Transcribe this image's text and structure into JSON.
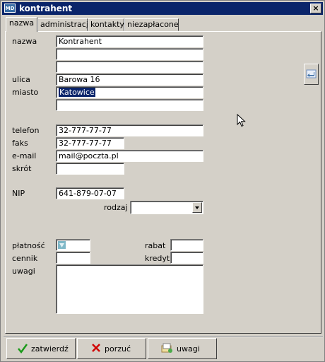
{
  "window": {
    "title": "kontrahent",
    "icon_text": "MD",
    "close_label": "×"
  },
  "tabs": [
    {
      "label": "nazwa",
      "active": true
    },
    {
      "label": "administracja",
      "active": false
    },
    {
      "label": "kontakty",
      "active": false
    },
    {
      "label": "niezapłacone",
      "active": false
    }
  ],
  "form": {
    "nazwa": {
      "label": "nazwa",
      "line1": "Kontrahent",
      "line2": "",
      "line3": ""
    },
    "ulica": {
      "label": "ulica",
      "value": "Barowa 16"
    },
    "miasto": {
      "label": "miasto",
      "value": "Katowice",
      "extra": ""
    },
    "telefon": {
      "label": "telefon",
      "value": "32-777-77-77"
    },
    "faks": {
      "label": "faks",
      "value": "32-777-77-77"
    },
    "email": {
      "label": "e-mail",
      "value": "mail@poczta.pl"
    },
    "skrot": {
      "label": "skrót",
      "value": ""
    },
    "nip": {
      "label": "NIP",
      "value": "641-879-07-07"
    },
    "rodzaj": {
      "label": "rodzaj",
      "value": ""
    },
    "platnosc": {
      "label": "płatność",
      "value": ""
    },
    "cennik": {
      "label": "cennik",
      "value": ""
    },
    "rabat": {
      "label": "rabat",
      "value": ""
    },
    "kredyt": {
      "label": "kredyt",
      "value": ""
    },
    "uwagi": {
      "label": "uwagi",
      "value": ""
    }
  },
  "buttons": {
    "confirm": {
      "label": "zatwierdź",
      "icon": "checkmark-icon",
      "color": "#1a9a1a"
    },
    "cancel": {
      "label": "porzuć",
      "icon": "x-icon",
      "color": "#d00000"
    },
    "notes": {
      "label": "uwagi",
      "icon": "notes-icon"
    }
  },
  "colors": {
    "title_bar": "#0a246a",
    "face": "#d4d0c8",
    "selection": "#0a246a"
  }
}
